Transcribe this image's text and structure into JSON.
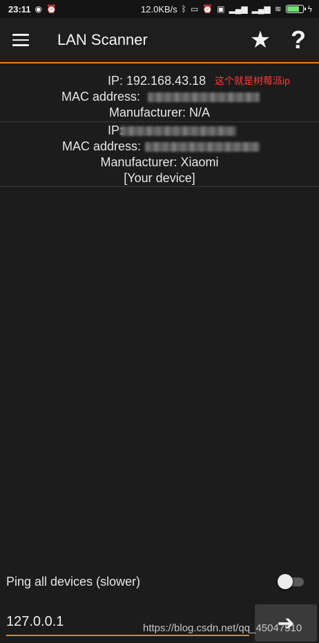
{
  "status_bar": {
    "time": "23:11",
    "speed": "12.0KB/s",
    "icons": [
      "weibo-icon",
      "alarm-icon",
      "bluetooth-icon",
      "vibrate-icon",
      "alarm-icon",
      "hd-icon",
      "signal-4g-icon",
      "signal-icon",
      "wifi-icon",
      "battery-icon",
      "charging-icon"
    ]
  },
  "app_bar": {
    "title": "LAN Scanner",
    "menu_icon": "hamburger-menu-icon",
    "favorite_icon": "star-icon",
    "help_icon": "help-icon",
    "help_glyph": "?",
    "star_glyph": "★"
  },
  "devices": [
    {
      "ip_label": "IP: 192.168.43.18",
      "mac_label": "MAC address: ",
      "manufacturer": "Manufacturer: N/A",
      "annotation": "这个就是树莓派ip"
    },
    {
      "ip_label": "IP:",
      "mac_label": "MAC address:",
      "manufacturer": "Manufacturer: Xiaomi",
      "note": "[Your device]"
    }
  ],
  "ping": {
    "label": "Ping all devices (slower)",
    "enabled": false
  },
  "input": {
    "value": "127.0.0.1"
  },
  "go_button": {
    "glyph": "➔"
  },
  "watermark": "https://blog.csdn.net/qq_45047510",
  "colors": {
    "accent": "#e8841f",
    "annotation": "#ff3a3a",
    "background": "#1c1c1c"
  }
}
